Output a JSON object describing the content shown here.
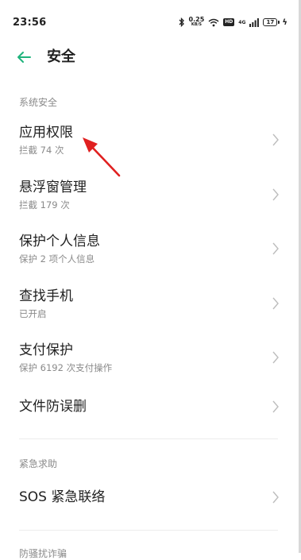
{
  "status_bar": {
    "time": "23:56",
    "speed_value": "0.25",
    "speed_unit": "KB/S",
    "hd": "HD",
    "network": "4G",
    "battery": "17",
    "icons": [
      "bluetooth-icon",
      "wifi-icon",
      "hd-icon",
      "signal-icon",
      "battery-icon",
      "charging-icon"
    ]
  },
  "header": {
    "title": "安全",
    "back_icon": "arrow-left-icon"
  },
  "sections": [
    {
      "label": "系统安全",
      "items": [
        {
          "title": "应用权限",
          "subtitle": "拦截 74 次"
        },
        {
          "title": "悬浮窗管理",
          "subtitle": "拦截 179 次"
        },
        {
          "title": "保护个人信息",
          "subtitle": "保护 2 项个人信息"
        },
        {
          "title": "查找手机",
          "subtitle": "已开启"
        },
        {
          "title": "支付保护",
          "subtitle": "保护 6192 次支付操作"
        },
        {
          "title": "文件防误删",
          "subtitle": ""
        }
      ]
    },
    {
      "label": "紧急求助",
      "items": [
        {
          "title": "SOS 紧急联络",
          "subtitle": ""
        }
      ]
    },
    {
      "label": "防骚扰诈骗",
      "items": []
    }
  ],
  "colors": {
    "accent": "#1fb37c",
    "annotation": "#e02020",
    "secondary_text": "#8a8a8a"
  }
}
